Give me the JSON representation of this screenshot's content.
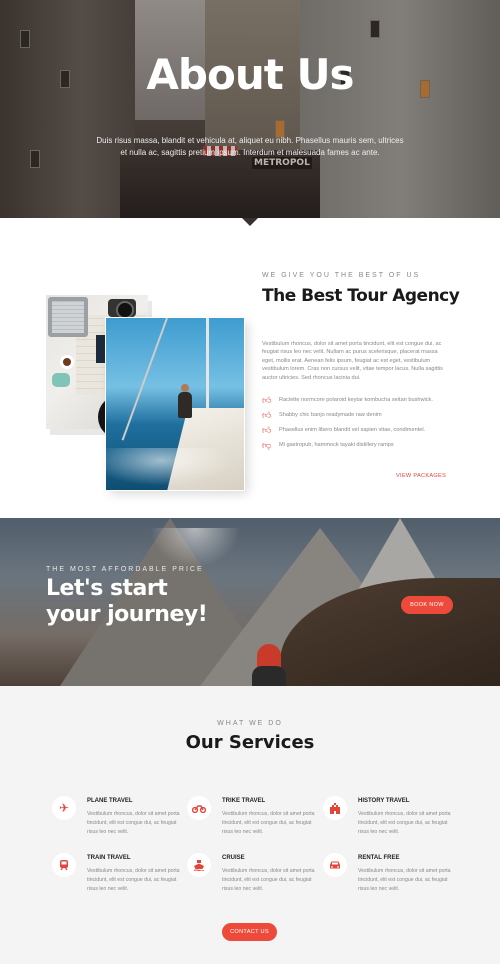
{
  "hero": {
    "title": "About Us",
    "text": "Duis risus massa, blandit et vehicula at, aliquet eu nibh. Phasellus mauris sem, ultrices et nulla ac, sagittis pretium ipsum. Interdum et malesuada fames ac ante.",
    "sign": "METROPOL"
  },
  "about": {
    "eyebrow": "WE GIVE YOU THE BEST OF US",
    "title": "The Best Tour Agency",
    "body": "Vestibulum rhoncus, dolor sit amet porta tincidunt, elit est congue dui, ac feugiat risus leo nec velit. Nullam ac purus scelerisque, placerat massa eget, mollis erat. Aenean felis ipsum, feugiat ac est eget, vestibulum vestibulum lorem. Cras non cursus velit, vitae tempor lacus. Nulla sagittis auctor ultricies. Sed rhoncus lacinia dui.",
    "features": [
      {
        "icon": "thumbs-up-icon",
        "text": "Raclette normcore polaroid keytar kombucha seitan bushwick."
      },
      {
        "icon": "thumbs-up-icon",
        "text": "Shabby chic banjo readymade raw denim"
      },
      {
        "icon": "thumbs-up-icon",
        "text": "Phasellus enim libero blandit vel sapien vitae, condimentel."
      },
      {
        "icon": "thumbs-down-icon",
        "text": "Mi gastropub, hammock tayaki distillery ramps"
      }
    ],
    "link": "VIEW PACKAGES"
  },
  "cta": {
    "eyebrow": "THE MOST AFFORDABLE PRICE",
    "title_line1": "Let's start",
    "title_line2": "your journey!",
    "button": "BOOK NOW"
  },
  "services": {
    "eyebrow": "WHAT WE DO",
    "title": "Our Services",
    "items": [
      {
        "title": "PLANE TRAVEL",
        "icon": "plane-icon",
        "text": "Vestibulum rhoncus, dolor sit amet porta tincidunt, elit est congue dui, ac feugiat risus leo nec velit."
      },
      {
        "title": "TRIKE TRAVEL",
        "icon": "motorcycle-icon",
        "text": "Vestibulum rhoncus, dolor sit amet porta tincidunt, elit est congue dui, ac feugiat risus leo nec velit."
      },
      {
        "title": "HISTORY TRAVEL",
        "icon": "castle-icon",
        "text": "Vestibulum rhoncus, dolor sit amet porta tincidunt, elit est congue dui, ac feugiat risus leo nec velit."
      },
      {
        "title": "TRAIN TRAVEL",
        "icon": "train-icon",
        "text": "Vestibulum rhoncus, dolor sit amet porta tincidunt, elit est congue dui, ac feugiat risus leo nec velit."
      },
      {
        "title": "CRUISE",
        "icon": "ship-icon",
        "text": "Vestibulum rhoncus, dolor sit amet porta tincidunt, elit est congue dui, ac feugiat risus leo nec velit."
      },
      {
        "title": "RENTAL FREE",
        "icon": "car-icon",
        "text": "Vestibulum rhoncus, dolor sit amet porta tincidunt, elit est congue dui, ac feugiat risus leo nec velit."
      }
    ],
    "button": "CONTACT US"
  },
  "colors": {
    "accent": "#ee4a3b",
    "heading": "#1a1a1a",
    "body": "#888888",
    "section_bg": "#f4f4f4"
  }
}
